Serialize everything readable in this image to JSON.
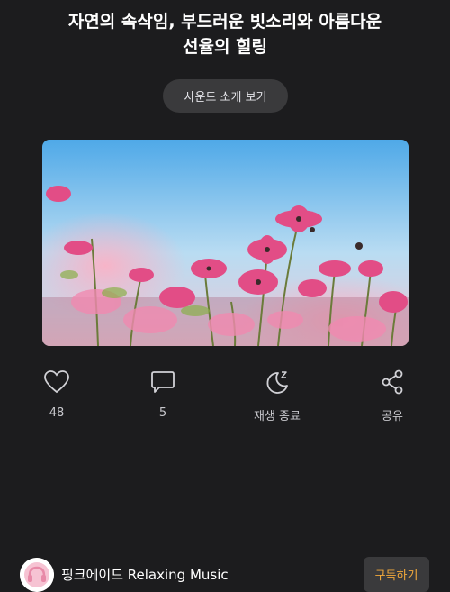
{
  "header": {
    "title_line1": "자연의 속삭임, 부드러운 빗소리와 아름다운",
    "title_line2": "선율의 힐링"
  },
  "sound_intro_button": "사운드 소개 보기",
  "actions": [
    {
      "icon": "heart-icon",
      "label": "48"
    },
    {
      "icon": "comment-icon",
      "label": "5"
    },
    {
      "icon": "sleep-moon-icon",
      "label": "재생 종료"
    },
    {
      "icon": "share-icon",
      "label": "공유"
    }
  ],
  "footer": {
    "channel_name": "핑크에이드 Relaxing Music",
    "subscribe_label": "구독하기"
  },
  "colors": {
    "background": "#1c1c1e",
    "accent": "#f2a93b",
    "button_bg": "#3a3a3c"
  }
}
